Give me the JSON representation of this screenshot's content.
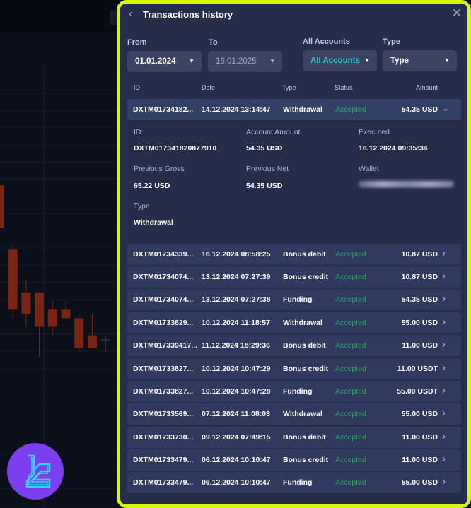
{
  "panel": {
    "title": "Transactions history",
    "back_icon": "chevron-left-icon",
    "close_icon": "close-icon"
  },
  "filters": {
    "from": {
      "label": "From",
      "value": "01.01.2024"
    },
    "to": {
      "label": "To",
      "value": "16.01.2025"
    },
    "accounts": {
      "label": "All Accounts",
      "value": "All Accounts"
    },
    "type": {
      "label": "Type",
      "value": "Type"
    }
  },
  "columns": [
    "ID",
    "Date",
    "Type",
    "Status",
    "Amount"
  ],
  "expanded": {
    "row": {
      "id": "DXTM01734182...",
      "date": "14.12.2024 13:14:47",
      "type": "Withdrawal",
      "status": "Accepted",
      "amount": "54.35 USD"
    },
    "fields": {
      "id_label": "ID:",
      "id_value": "DXTM017341820877910",
      "account_amount_label": "Account Amount",
      "account_amount_value": "54.35 USD",
      "executed_label": "Executed",
      "executed_value": "16.12.2024 09:35:34",
      "previous_gross_label": "Previous Gross",
      "previous_gross_value": "65.22 USD",
      "previous_net_label": "Previous Net",
      "previous_net_value": "54.35 USD",
      "wallet_label": "Wallet",
      "type_label": "Type",
      "type_value": "Withdrawal"
    }
  },
  "rows": [
    {
      "id": "DXTM01734339...",
      "date": "16.12.2024 08:58:25",
      "type": "Bonus debit",
      "status": "Accepted",
      "amount": "10.87 USD"
    },
    {
      "id": "DXTM01734074...",
      "date": "13.12.2024 07:27:39",
      "type": "Bonus credit",
      "status": "Accepted",
      "amount": "10.87 USD"
    },
    {
      "id": "DXTM01734074...",
      "date": "13.12.2024 07:27:38",
      "type": "Funding",
      "status": "Accepted",
      "amount": "54.35 USD"
    },
    {
      "id": "DXTM01733829...",
      "date": "10.12.2024 11:18:57",
      "type": "Withdrawal",
      "status": "Accepted",
      "amount": "55.00 USD"
    },
    {
      "id": "DXTM017339417...",
      "date": "11.12.2024 18:29:36",
      "type": "Bonus debit",
      "status": "Accepted",
      "amount": "11.00 USD"
    },
    {
      "id": "DXTM01733827...",
      "date": "10.12.2024 10:47:29",
      "type": "Bonus credit",
      "status": "Accepted",
      "amount": "11.00 USDT"
    },
    {
      "id": "DXTM01733827...",
      "date": "10.12.2024 10:47:28",
      "type": "Funding",
      "status": "Accepted",
      "amount": "55.00 USDT"
    },
    {
      "id": "DXTM01733569...",
      "date": "07.12.2024 11:08:03",
      "type": "Withdrawal",
      "status": "Accepted",
      "amount": "55.00 USD"
    },
    {
      "id": "DXTM01733730...",
      "date": "09.12.2024 07:49:15",
      "type": "Bonus debit",
      "status": "Accepted",
      "amount": "11.00 USD"
    },
    {
      "id": "DXTM01733479...",
      "date": "06.12.2024 10:10:47",
      "type": "Bonus credit",
      "status": "Accepted",
      "amount": "11.00 USD"
    },
    {
      "id": "DXTM01733479...",
      "date": "06.12.2024 10:10:47",
      "type": "Funding",
      "status": "Accepted",
      "amount": "55.00 USD"
    }
  ],
  "colors": {
    "highlight": "#d4f707",
    "accepted": "#2fa364",
    "teal": "#2ec4d6",
    "logo_bg": "#7b3ff0",
    "logo_fg": "#28d8f5",
    "bull": "#1e4a30",
    "bear": "#7a2414"
  },
  "background_chart": {
    "candles": [
      {
        "o": 0.72,
        "c": 0.62,
        "h": 0.72,
        "l": 0.6
      },
      {
        "o": 0.57,
        "c": 0.43,
        "h": 0.58,
        "l": 0.41
      },
      {
        "o": 0.47,
        "c": 0.42,
        "h": 0.5,
        "l": 0.39
      },
      {
        "o": 0.47,
        "c": 0.39,
        "h": 0.47,
        "l": 0.32
      },
      {
        "o": 0.43,
        "c": 0.39,
        "h": 0.45,
        "l": 0.37
      },
      {
        "o": 0.43,
        "c": 0.41,
        "h": 0.45,
        "l": 0.41
      },
      {
        "o": 0.41,
        "c": 0.34,
        "h": 0.42,
        "l": 0.33
      },
      {
        "o": 0.37,
        "c": 0.34,
        "h": 0.42,
        "l": 0.34
      },
      {
        "o": 0.36,
        "c": 0.36,
        "h": 0.37,
        "l": 0.33
      }
    ]
  }
}
